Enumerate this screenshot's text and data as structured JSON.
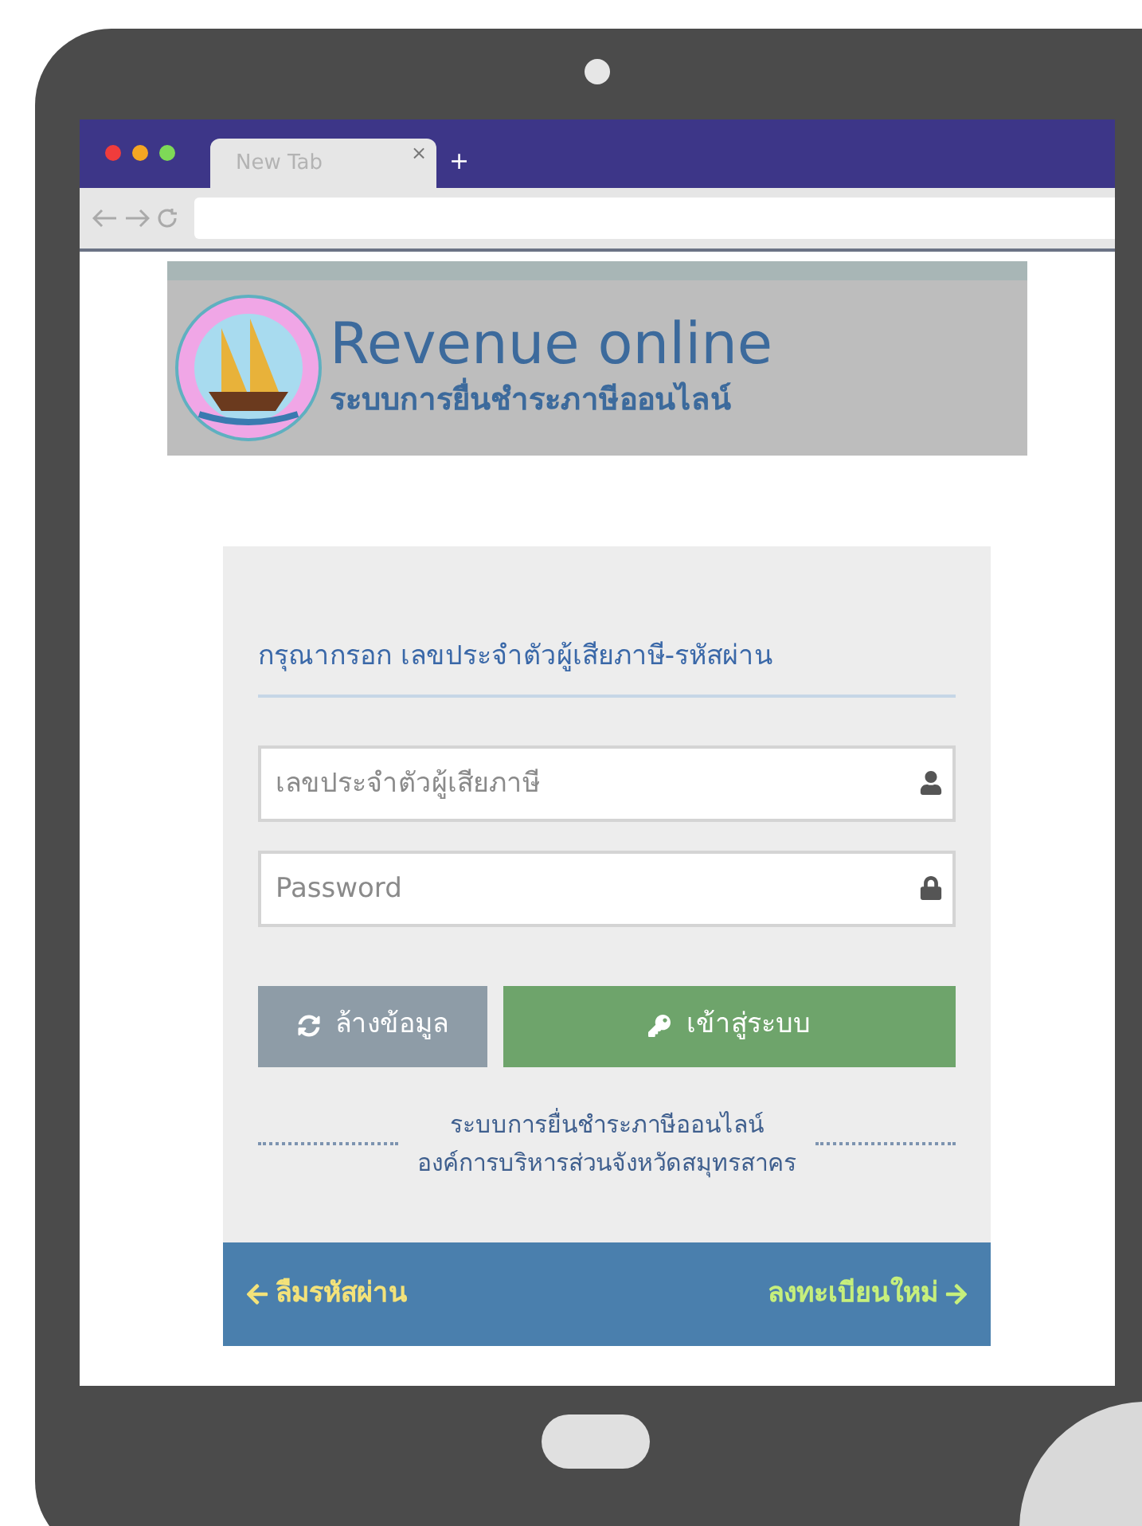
{
  "browser": {
    "tab_title": "New Tab",
    "tab_close": "×",
    "new_tab": "+"
  },
  "header": {
    "title": "Revenue online",
    "subtitle": "ระบบการยื่นชำระภาษีออนไลน์"
  },
  "login": {
    "heading": "กรุณากรอก เลขประจำตัวผู้เสียภาษี-รหัสผ่าน",
    "fields": [
      {
        "placeholder": "เลขประจำตัวผู้เสียภาษี",
        "kind": "user"
      },
      {
        "placeholder": "Password",
        "kind": "password"
      }
    ],
    "buttons": [
      {
        "label": "ล้างข้อมูล",
        "kind": "reset"
      },
      {
        "label": "เข้าสู่ระบบ",
        "kind": "submit"
      }
    ],
    "footer_lines": [
      "ระบบการยื่นชำระภาษีออนไลน์",
      "องค์การบริหารส่วนจังหวัดสมุทรสาคร"
    ]
  },
  "links": [
    {
      "label": "ลืมรหัสผ่าน",
      "kind": "back"
    },
    {
      "label": "ลงทะเบียนใหม่",
      "kind": "forward"
    }
  ]
}
